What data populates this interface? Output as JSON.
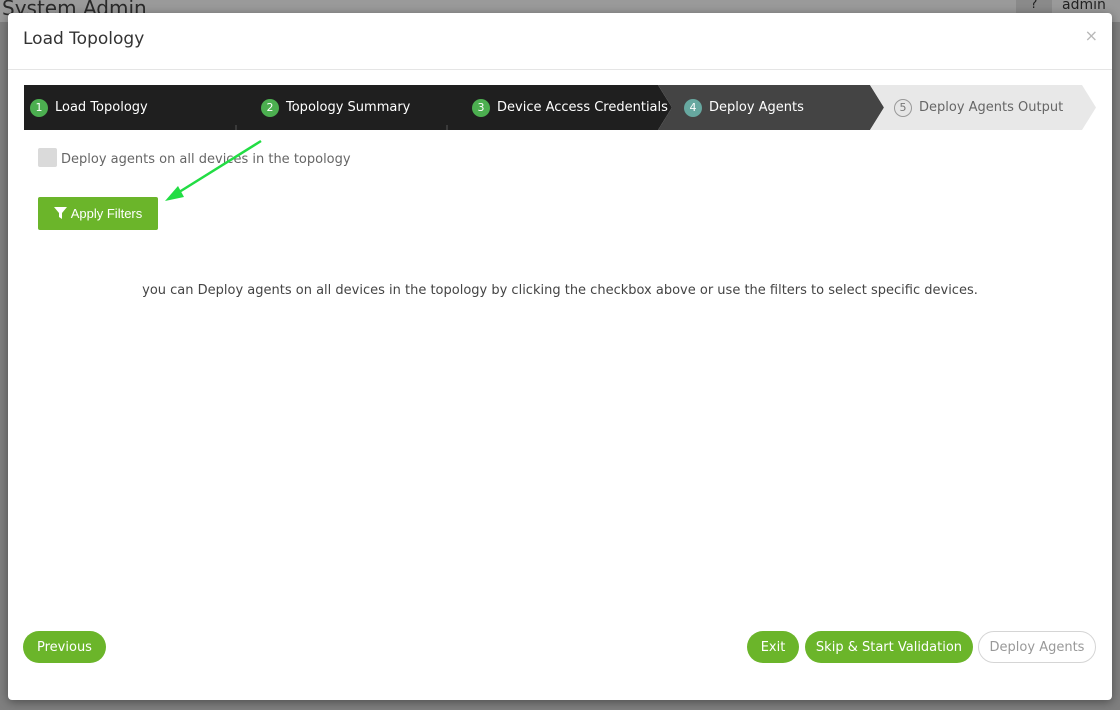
{
  "background": {
    "title": "System Admin",
    "help_label": "?",
    "user_label": "admin"
  },
  "modal": {
    "title": "Load Topology",
    "close_label": "×"
  },
  "wizard": {
    "steps": [
      {
        "num": "1",
        "label": "Load Topology",
        "state": "done"
      },
      {
        "num": "2",
        "label": "Topology Summary",
        "state": "done"
      },
      {
        "num": "3",
        "label": "Device Access Credentials",
        "state": "done"
      },
      {
        "num": "4",
        "label": "Deploy Agents",
        "state": "active"
      },
      {
        "num": "5",
        "label": "Deploy Agents Output",
        "state": "todo"
      }
    ]
  },
  "deploy": {
    "checkbox_label": "Deploy agents on all devices in the topology",
    "apply_filters_label": "Apply Filters",
    "info_text": "you can Deploy agents on all devices in the topology by clicking the checkbox above or use the filters to select specific devices."
  },
  "footer": {
    "previous_label": "Previous",
    "exit_label": "Exit",
    "skip_label": "Skip & Start Validation",
    "deploy_label": "Deploy Agents"
  },
  "colors": {
    "accent_green": "#6bb52a",
    "done_step_bg": "#1f1f1f",
    "active_step_bg": "#444444",
    "todo_step_bg": "#e8e8e8",
    "annotation_arrow": "#22dd44"
  }
}
